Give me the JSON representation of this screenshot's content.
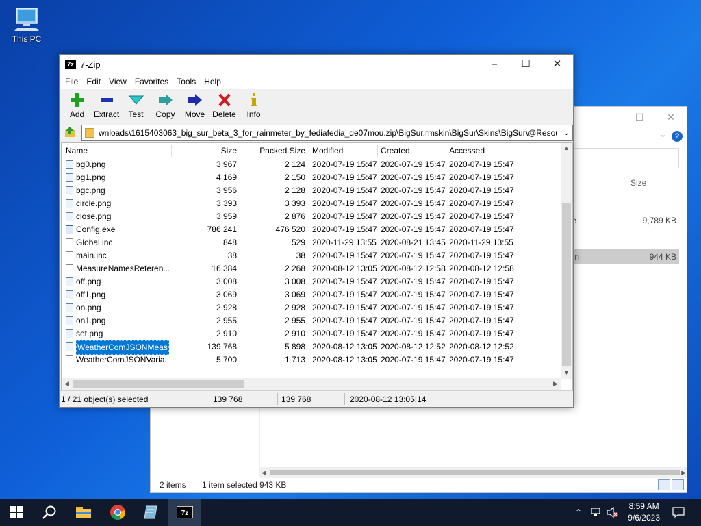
{
  "desktop": {
    "icon_label": "This PC"
  },
  "background_window": {
    "header_size": "Size",
    "rows": [
      {
        "name": "hive",
        "size": "9,789 KB"
      },
      {
        "name": "ation",
        "size": "944 KB"
      }
    ],
    "status": {
      "items": "2 items",
      "selected": "1 item selected  943 KB"
    }
  },
  "window": {
    "title": "7-Zip",
    "app_icon": "7z",
    "menu": [
      "File",
      "Edit",
      "View",
      "Favorites",
      "Tools",
      "Help"
    ],
    "toolbar": [
      {
        "id": "add",
        "label": "Add",
        "icon": "plus-icon",
        "color": "#1fa01f"
      },
      {
        "id": "extract",
        "label": "Extract",
        "icon": "minus-icon",
        "color": "#1e32b4"
      },
      {
        "id": "test",
        "label": "Test",
        "icon": "check-icon",
        "color": "#2cb8b8"
      },
      {
        "id": "copy",
        "label": "Copy",
        "icon": "arrow-right-icon",
        "color": "#2c9e9e"
      },
      {
        "id": "move",
        "label": "Move",
        "icon": "arrow-right-icon",
        "color": "#1e2aa8"
      },
      {
        "id": "delete",
        "label": "Delete",
        "icon": "x-icon",
        "color": "#d11a1a"
      },
      {
        "id": "info",
        "label": "Info",
        "icon": "info-icon",
        "color": "#c4a800"
      }
    ],
    "address": "wnloads\\1615403063_big_sur_beta_3_for_rainmeter_by_fediafedia_de07mou.zip\\BigSur.rmskin\\BigSur\\Skins\\BigSur\\@Resources\\",
    "columns": [
      "Name",
      "Size",
      "Packed Size",
      "Modified",
      "Created",
      "Accessed"
    ],
    "files": [
      {
        "name": "bg0.png",
        "type": "img",
        "size": "3 967",
        "packed": "2 124",
        "modified": "2020-07-19 15:47",
        "created": "2020-07-19 15:47",
        "accessed": "2020-07-19 15:47"
      },
      {
        "name": "bg1.png",
        "type": "img",
        "size": "4 169",
        "packed": "2 150",
        "modified": "2020-07-19 15:47",
        "created": "2020-07-19 15:47",
        "accessed": "2020-07-19 15:47"
      },
      {
        "name": "bgc.png",
        "type": "img",
        "size": "3 956",
        "packed": "2 128",
        "modified": "2020-07-19 15:47",
        "created": "2020-07-19 15:47",
        "accessed": "2020-07-19 15:47"
      },
      {
        "name": "circle.png",
        "type": "img",
        "size": "3 393",
        "packed": "3 393",
        "modified": "2020-07-19 15:47",
        "created": "2020-07-19 15:47",
        "accessed": "2020-07-19 15:47"
      },
      {
        "name": "close.png",
        "type": "img",
        "size": "3 959",
        "packed": "2 876",
        "modified": "2020-07-19 15:47",
        "created": "2020-07-19 15:47",
        "accessed": "2020-07-19 15:47"
      },
      {
        "name": "Config.exe",
        "type": "exe",
        "size": "786 241",
        "packed": "476 520",
        "modified": "2020-07-19 15:47",
        "created": "2020-07-19 15:47",
        "accessed": "2020-07-19 15:47"
      },
      {
        "name": "Global.inc",
        "type": "txt",
        "size": "848",
        "packed": "529",
        "modified": "2020-11-29 13:55",
        "created": "2020-08-21 13:45",
        "accessed": "2020-11-29 13:55"
      },
      {
        "name": "main.inc",
        "type": "txt",
        "size": "38",
        "packed": "38",
        "modified": "2020-07-19 15:47",
        "created": "2020-07-19 15:47",
        "accessed": "2020-07-19 15:47"
      },
      {
        "name": "MeasureNamesReferen...",
        "type": "txt",
        "size": "16 384",
        "packed": "2 268",
        "modified": "2020-08-12 13:05",
        "created": "2020-08-12 12:58",
        "accessed": "2020-08-12 12:58"
      },
      {
        "name": "off.png",
        "type": "img",
        "size": "3 008",
        "packed": "3 008",
        "modified": "2020-07-19 15:47",
        "created": "2020-07-19 15:47",
        "accessed": "2020-07-19 15:47"
      },
      {
        "name": "off1.png",
        "type": "img",
        "size": "3 069",
        "packed": "3 069",
        "modified": "2020-07-19 15:47",
        "created": "2020-07-19 15:47",
        "accessed": "2020-07-19 15:47"
      },
      {
        "name": "on.png",
        "type": "img",
        "size": "2 928",
        "packed": "2 928",
        "modified": "2020-07-19 15:47",
        "created": "2020-07-19 15:47",
        "accessed": "2020-07-19 15:47"
      },
      {
        "name": "on1.png",
        "type": "img",
        "size": "2 955",
        "packed": "2 955",
        "modified": "2020-07-19 15:47",
        "created": "2020-07-19 15:47",
        "accessed": "2020-07-19 15:47"
      },
      {
        "name": "set.png",
        "type": "img",
        "size": "2 910",
        "packed": "2 910",
        "modified": "2020-07-19 15:47",
        "created": "2020-07-19 15:47",
        "accessed": "2020-07-19 15:47"
      },
      {
        "name": "WeatherComJSONMeas...",
        "type": "img",
        "selected": true,
        "size": "139 768",
        "packed": "5 898",
        "modified": "2020-08-12 13:05",
        "created": "2020-08-12 12:52",
        "accessed": "2020-08-12 12:52"
      },
      {
        "name": "WeatherComJSONVaria...",
        "type": "txt",
        "size": "5 700",
        "packed": "1 713",
        "modified": "2020-08-12 13:05",
        "created": "2020-07-19 15:47",
        "accessed": "2020-07-19 15:47"
      }
    ],
    "status": {
      "selection": "1 / 21 object(s) selected",
      "size": "139 768",
      "packed": "139 768",
      "modified": "2020-08-12 13:05:14"
    }
  },
  "taskbar": {
    "clock_time": "8:59 AM",
    "clock_date": "9/6/2023"
  },
  "colors": {
    "accent": "#0078d7",
    "taskbar": "#101a2c"
  }
}
